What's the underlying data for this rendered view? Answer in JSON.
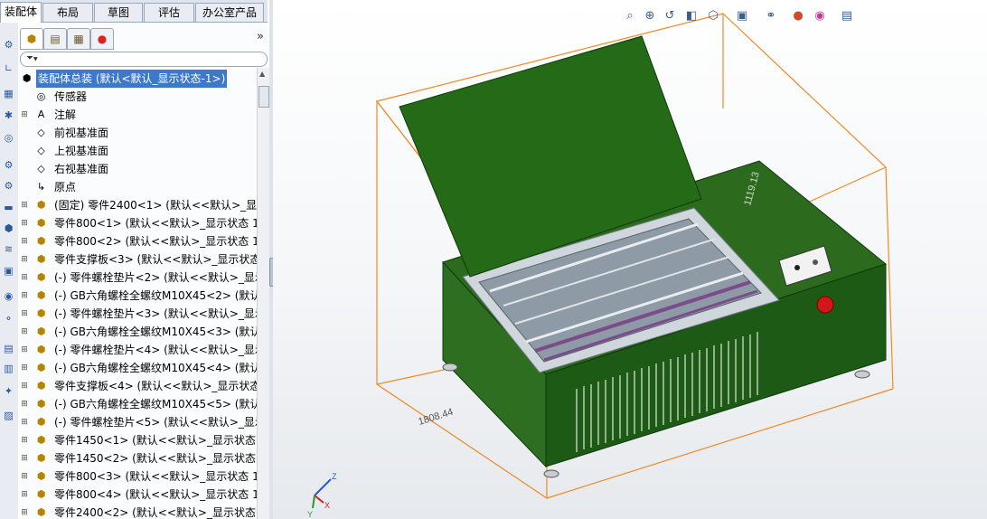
{
  "tabs": [
    "装配体",
    "布局",
    "草图",
    "评估",
    "办公室产品"
  ],
  "tabs_active": 0,
  "fm_tabs": [
    {
      "name": "feature-manager-tab",
      "icon": "assembly-icon"
    },
    {
      "name": "property-manager-tab",
      "icon": "property-icon"
    },
    {
      "name": "configuration-manager-tab",
      "icon": "config-icon"
    },
    {
      "name": "display-manager-tab",
      "icon": "appearance-icon"
    }
  ],
  "more_symbol": "»",
  "filter_symbol": "▼",
  "tree": {
    "root": "装配体总装  (默认<默认_显示状态-1>)",
    "items": [
      {
        "label": "传感器",
        "icon": "sensor-icon",
        "expand": false
      },
      {
        "label": "注解",
        "icon": "annotation-icon",
        "expand": true
      },
      {
        "label": "前视基准面",
        "icon": "plane-icon",
        "expand": false
      },
      {
        "label": "上视基准面",
        "icon": "plane-icon",
        "expand": false
      },
      {
        "label": "右视基准面",
        "icon": "plane-icon",
        "expand": false
      },
      {
        "label": "原点",
        "icon": "origin-icon",
        "expand": false
      },
      {
        "label": "(固定) 零件2400<1> (默认<<默认>_显示",
        "icon": "part-icon",
        "expand": true
      },
      {
        "label": "零件800<1> (默认<<默认>_显示状态 1>",
        "icon": "part-icon",
        "expand": true
      },
      {
        "label": "零件800<2> (默认<<默认>_显示状态 1>",
        "icon": "part-icon",
        "expand": true
      },
      {
        "label": "零件支撑板<3> (默认<<默认>_显示状态",
        "icon": "part-icon",
        "expand": true
      },
      {
        "label": "(-) 零件螺栓垫片<2> (默认<<默认>_显示",
        "icon": "part-icon",
        "expand": true
      },
      {
        "label": "(-) GB六角螺栓全螺纹M10X45<2> (默认",
        "icon": "part-icon",
        "expand": true
      },
      {
        "label": "(-) 零件螺栓垫片<3> (默认<<默认>_显示",
        "icon": "part-icon",
        "expand": true
      },
      {
        "label": "(-) GB六角螺栓全螺纹M10X45<3> (默认",
        "icon": "part-icon",
        "expand": true
      },
      {
        "label": "(-) 零件螺栓垫片<4> (默认<<默认>_显示",
        "icon": "part-icon",
        "expand": true
      },
      {
        "label": "(-) GB六角螺栓全螺纹M10X45<4> (默认",
        "icon": "part-icon",
        "expand": true
      },
      {
        "label": "零件支撑板<4> (默认<<默认>_显示状态",
        "icon": "part-icon",
        "expand": true
      },
      {
        "label": "(-) GB六角螺栓全螺纹M10X45<5> (默认",
        "icon": "part-icon",
        "expand": true
      },
      {
        "label": "(-) 零件螺栓垫片<5> (默认<<默认>_显示",
        "icon": "part-icon",
        "expand": true
      },
      {
        "label": "零件1450<1> (默认<<默认>_显示状态 1",
        "icon": "part-icon",
        "expand": true
      },
      {
        "label": "零件1450<2> (默认<<默认>_显示状态 1",
        "icon": "part-icon",
        "expand": true
      },
      {
        "label": "零件800<3> (默认<<默认>_显示状态 1>",
        "icon": "part-icon",
        "expand": true
      },
      {
        "label": "零件800<4> (默认<<默认>_显示状态 1>",
        "icon": "part-icon",
        "expand": true
      },
      {
        "label": "零件2400<2> (默认<<默认>_显示状态 1",
        "icon": "part-icon",
        "expand": true
      }
    ]
  },
  "viewport": {
    "dimension_front": "1808.44",
    "dimension_side": "1119.13",
    "triad": {
      "z": "Z",
      "x": "X",
      "y": "Y"
    },
    "toolbar_icons": [
      "zoom-fit-icon",
      "zoom-area-icon",
      "previous-view-icon",
      "section-view-icon",
      "view-orientation-icon",
      "display-style-icon",
      "hide-show-icon",
      "appearance-icon",
      "scene-icon",
      "view-settings-icon"
    ],
    "colors": {
      "machine_green": "#1f5f16",
      "bbox_orange": "#f08a24",
      "stop_button": "#d01818"
    }
  }
}
